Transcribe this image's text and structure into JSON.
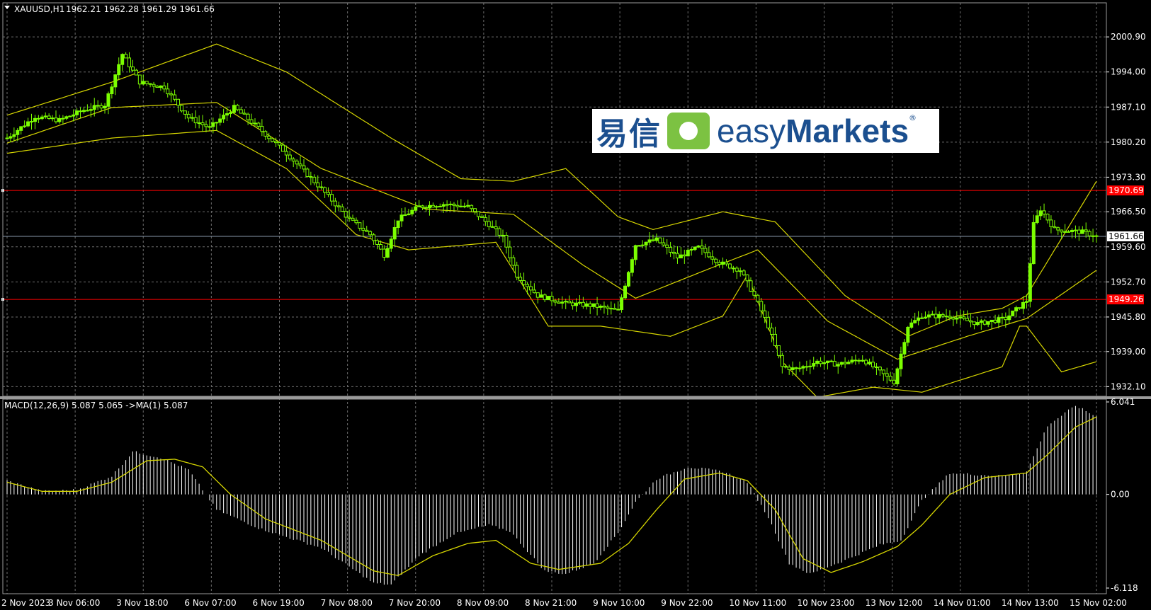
{
  "header": {
    "symbol": "XAUUSD,H1",
    "ohlc": "1962.21 1962.28 1961.29 1961.66",
    "macd_label": "MACD(12,26,9) 5.087 5.065 ->MA(1) 5.087"
  },
  "logo": {
    "cn": "易信",
    "en_light": "easy",
    "en_bold": "Markets",
    "reg": "®"
  },
  "colors": {
    "background": "#000000",
    "grid": "#6e6e6e",
    "bull": "#7cff00",
    "bear": "#000000",
    "bollinger": "#d6d600",
    "hline": "#ff0000",
    "current": "#8899aa",
    "macd_hist": "#ffffff",
    "macd_signal": "#d6d600",
    "price_tag": "#ff0000"
  },
  "chart_data": [
    {
      "type": "candlestick",
      "title": "XAUUSD,H1",
      "y_ticks": [
        2000.9,
        1994.0,
        1987.1,
        1980.2,
        1973.3,
        1966.5,
        1959.6,
        1952.7,
        1945.8,
        1939.0,
        1932.1
      ],
      "ylim": [
        1930.2,
        2007.6
      ],
      "x_labels": [
        "2 Nov 2023",
        "3 Nov 06:00",
        "3 Nov 18:00",
        "6 Nov 07:00",
        "6 Nov 19:00",
        "7 Nov 08:00",
        "7 Nov 20:00",
        "8 Nov 09:00",
        "8 Nov 21:00",
        "9 Nov 10:00",
        "9 Nov 22:00",
        "10 Nov 11:00",
        "10 Nov 23:00",
        "13 Nov 12:00",
        "14 Nov 01:00",
        "14 Nov 13:00",
        "15 Nov 02:00"
      ],
      "horizontal_lines": [
        {
          "label": "1970.69",
          "value": 1970.69
        },
        {
          "label": "1949.26",
          "value": 1949.26
        }
      ],
      "current_price": {
        "label": "1961.66",
        "value": 1961.66
      },
      "close_anchors": [
        [
          0,
          1981.0
        ],
        [
          8,
          1985.2
        ],
        [
          15,
          1984.5
        ],
        [
          22,
          1986.5
        ],
        [
          28,
          1987.5
        ],
        [
          33,
          1997.5
        ],
        [
          38,
          1992.0
        ],
        [
          45,
          1991.0
        ],
        [
          52,
          1985.0
        ],
        [
          58,
          1983.0
        ],
        [
          65,
          1987.0
        ],
        [
          72,
          1983.0
        ],
        [
          80,
          1978.0
        ],
        [
          90,
          1971.0
        ],
        [
          98,
          1965.0
        ],
        [
          104,
          1962.0
        ],
        [
          108,
          1958.0
        ],
        [
          112,
          1965.0
        ],
        [
          118,
          1967.5
        ],
        [
          125,
          1968.0
        ],
        [
          132,
          1967.5
        ],
        [
          138,
          1964.0
        ],
        [
          142,
          1961.5
        ],
        [
          146,
          1954.0
        ],
        [
          152,
          1950.0
        ],
        [
          160,
          1948.5
        ],
        [
          168,
          1948.0
        ],
        [
          175,
          1947.0
        ],
        [
          180,
          1960.0
        ],
        [
          186,
          1961.0
        ],
        [
          192,
          1957.5
        ],
        [
          198,
          1959.5
        ],
        [
          204,
          1956.5
        ],
        [
          210,
          1955.0
        ],
        [
          214,
          1950.0
        ],
        [
          218,
          1944.0
        ],
        [
          222,
          1936.0
        ],
        [
          226,
          1935.5
        ],
        [
          232,
          1937.0
        ],
        [
          238,
          1936.5
        ],
        [
          245,
          1937.5
        ],
        [
          250,
          1935.0
        ],
        [
          254,
          1933.0
        ],
        [
          258,
          1944.0
        ],
        [
          262,
          1946.0
        ],
        [
          270,
          1946.0
        ],
        [
          278,
          1944.5
        ],
        [
          286,
          1945.5
        ],
        [
          292,
          1949.0
        ],
        [
          294,
          1964.0
        ],
        [
          296,
          1967.0
        ],
        [
          300,
          1963.0
        ],
        [
          308,
          1962.5
        ],
        [
          312,
          1961.66
        ]
      ],
      "bollinger": {
        "upper": [
          [
            0,
            1985.5
          ],
          [
            30,
            1992.0
          ],
          [
            60,
            1999.5
          ],
          [
            80,
            1994.0
          ],
          [
            110,
            1981.0
          ],
          [
            130,
            1973.0
          ],
          [
            145,
            1972.5
          ],
          [
            160,
            1975.0
          ],
          [
            175,
            1965.5
          ],
          [
            185,
            1963.0
          ],
          [
            205,
            1966.5
          ],
          [
            220,
            1964.5
          ],
          [
            240,
            1950.0
          ],
          [
            258,
            1942.0
          ],
          [
            272,
            1946.0
          ],
          [
            285,
            1947.5
          ],
          [
            292,
            1950.0
          ],
          [
            312,
            1972.5
          ]
        ],
        "middle": [
          [
            0,
            1980.0
          ],
          [
            30,
            1987.0
          ],
          [
            60,
            1988.0
          ],
          [
            90,
            1975.0
          ],
          [
            120,
            1967.0
          ],
          [
            145,
            1966.0
          ],
          [
            165,
            1956.0
          ],
          [
            180,
            1949.5
          ],
          [
            200,
            1955.0
          ],
          [
            215,
            1959.0
          ],
          [
            235,
            1945.0
          ],
          [
            255,
            1937.5
          ],
          [
            275,
            1942.0
          ],
          [
            292,
            1945.5
          ],
          [
            312,
            1955.0
          ]
        ],
        "lower": [
          [
            0,
            1978.0
          ],
          [
            30,
            1981.0
          ],
          [
            60,
            1982.5
          ],
          [
            80,
            1975.0
          ],
          [
            100,
            1962.0
          ],
          [
            115,
            1959.0
          ],
          [
            140,
            1960.5
          ],
          [
            155,
            1944.0
          ],
          [
            170,
            1944.0
          ],
          [
            190,
            1942.0
          ],
          [
            205,
            1946.0
          ],
          [
            212,
            1954.0
          ],
          [
            222,
            1937.0
          ],
          [
            232,
            1930.0
          ],
          [
            248,
            1932.0
          ],
          [
            262,
            1931.0
          ],
          [
            285,
            1936.0
          ],
          [
            290,
            1944.0
          ],
          [
            292,
            1944.0
          ],
          [
            302,
            1935.0
          ],
          [
            312,
            1937.0
          ]
        ]
      }
    },
    {
      "type": "bar",
      "title": "MACD(12,26,9) 5.087 5.065 ->MA(1) 5.087",
      "y_ticks": [
        6.041,
        0.0,
        -6.118
      ],
      "ylim": [
        -6.118,
        6.041
      ],
      "histogram_anchors": [
        [
          0,
          0.9
        ],
        [
          10,
          0.2
        ],
        [
          20,
          0.3
        ],
        [
          30,
          1.2
        ],
        [
          36,
          2.8
        ],
        [
          44,
          2.4
        ],
        [
          52,
          1.6
        ],
        [
          60,
          -1.0
        ],
        [
          72,
          -2.2
        ],
        [
          90,
          -3.5
        ],
        [
          105,
          -5.8
        ],
        [
          110,
          -5.9
        ],
        [
          118,
          -4.0
        ],
        [
          128,
          -2.6
        ],
        [
          138,
          -2.0
        ],
        [
          144,
          -2.4
        ],
        [
          154,
          -5.0
        ],
        [
          160,
          -5.2
        ],
        [
          168,
          -4.5
        ],
        [
          175,
          -2.5
        ],
        [
          180,
          -0.5
        ],
        [
          186,
          1.0
        ],
        [
          195,
          1.8
        ],
        [
          205,
          1.5
        ],
        [
          212,
          0.8
        ],
        [
          218,
          -1.5
        ],
        [
          224,
          -4.5
        ],
        [
          230,
          -5.2
        ],
        [
          240,
          -4.3
        ],
        [
          250,
          -3.3
        ],
        [
          256,
          -3.0
        ],
        [
          262,
          -0.4
        ],
        [
          270,
          1.4
        ],
        [
          285,
          1.2
        ],
        [
          292,
          1.5
        ],
        [
          298,
          4.5
        ],
        [
          306,
          5.8
        ],
        [
          312,
          5.087
        ]
      ],
      "signal_anchors": [
        [
          0,
          0.8
        ],
        [
          10,
          0.2
        ],
        [
          20,
          0.2
        ],
        [
          30,
          0.8
        ],
        [
          40,
          2.2
        ],
        [
          48,
          2.3
        ],
        [
          56,
          1.8
        ],
        [
          64,
          0.0
        ],
        [
          74,
          -1.6
        ],
        [
          90,
          -3.0
        ],
        [
          105,
          -5.0
        ],
        [
          112,
          -5.3
        ],
        [
          122,
          -4.0
        ],
        [
          132,
          -3.2
        ],
        [
          140,
          -3.0
        ],
        [
          150,
          -4.5
        ],
        [
          158,
          -4.9
        ],
        [
          170,
          -4.5
        ],
        [
          178,
          -3.2
        ],
        [
          186,
          -1.0
        ],
        [
          194,
          1.0
        ],
        [
          204,
          1.4
        ],
        [
          212,
          0.9
        ],
        [
          220,
          -1.0
        ],
        [
          228,
          -4.2
        ],
        [
          236,
          -5.1
        ],
        [
          245,
          -4.4
        ],
        [
          255,
          -3.4
        ],
        [
          262,
          -2.0
        ],
        [
          270,
          0.0
        ],
        [
          280,
          1.1
        ],
        [
          292,
          1.4
        ],
        [
          298,
          2.6
        ],
        [
          306,
          4.4
        ],
        [
          312,
          5.065
        ]
      ]
    }
  ]
}
